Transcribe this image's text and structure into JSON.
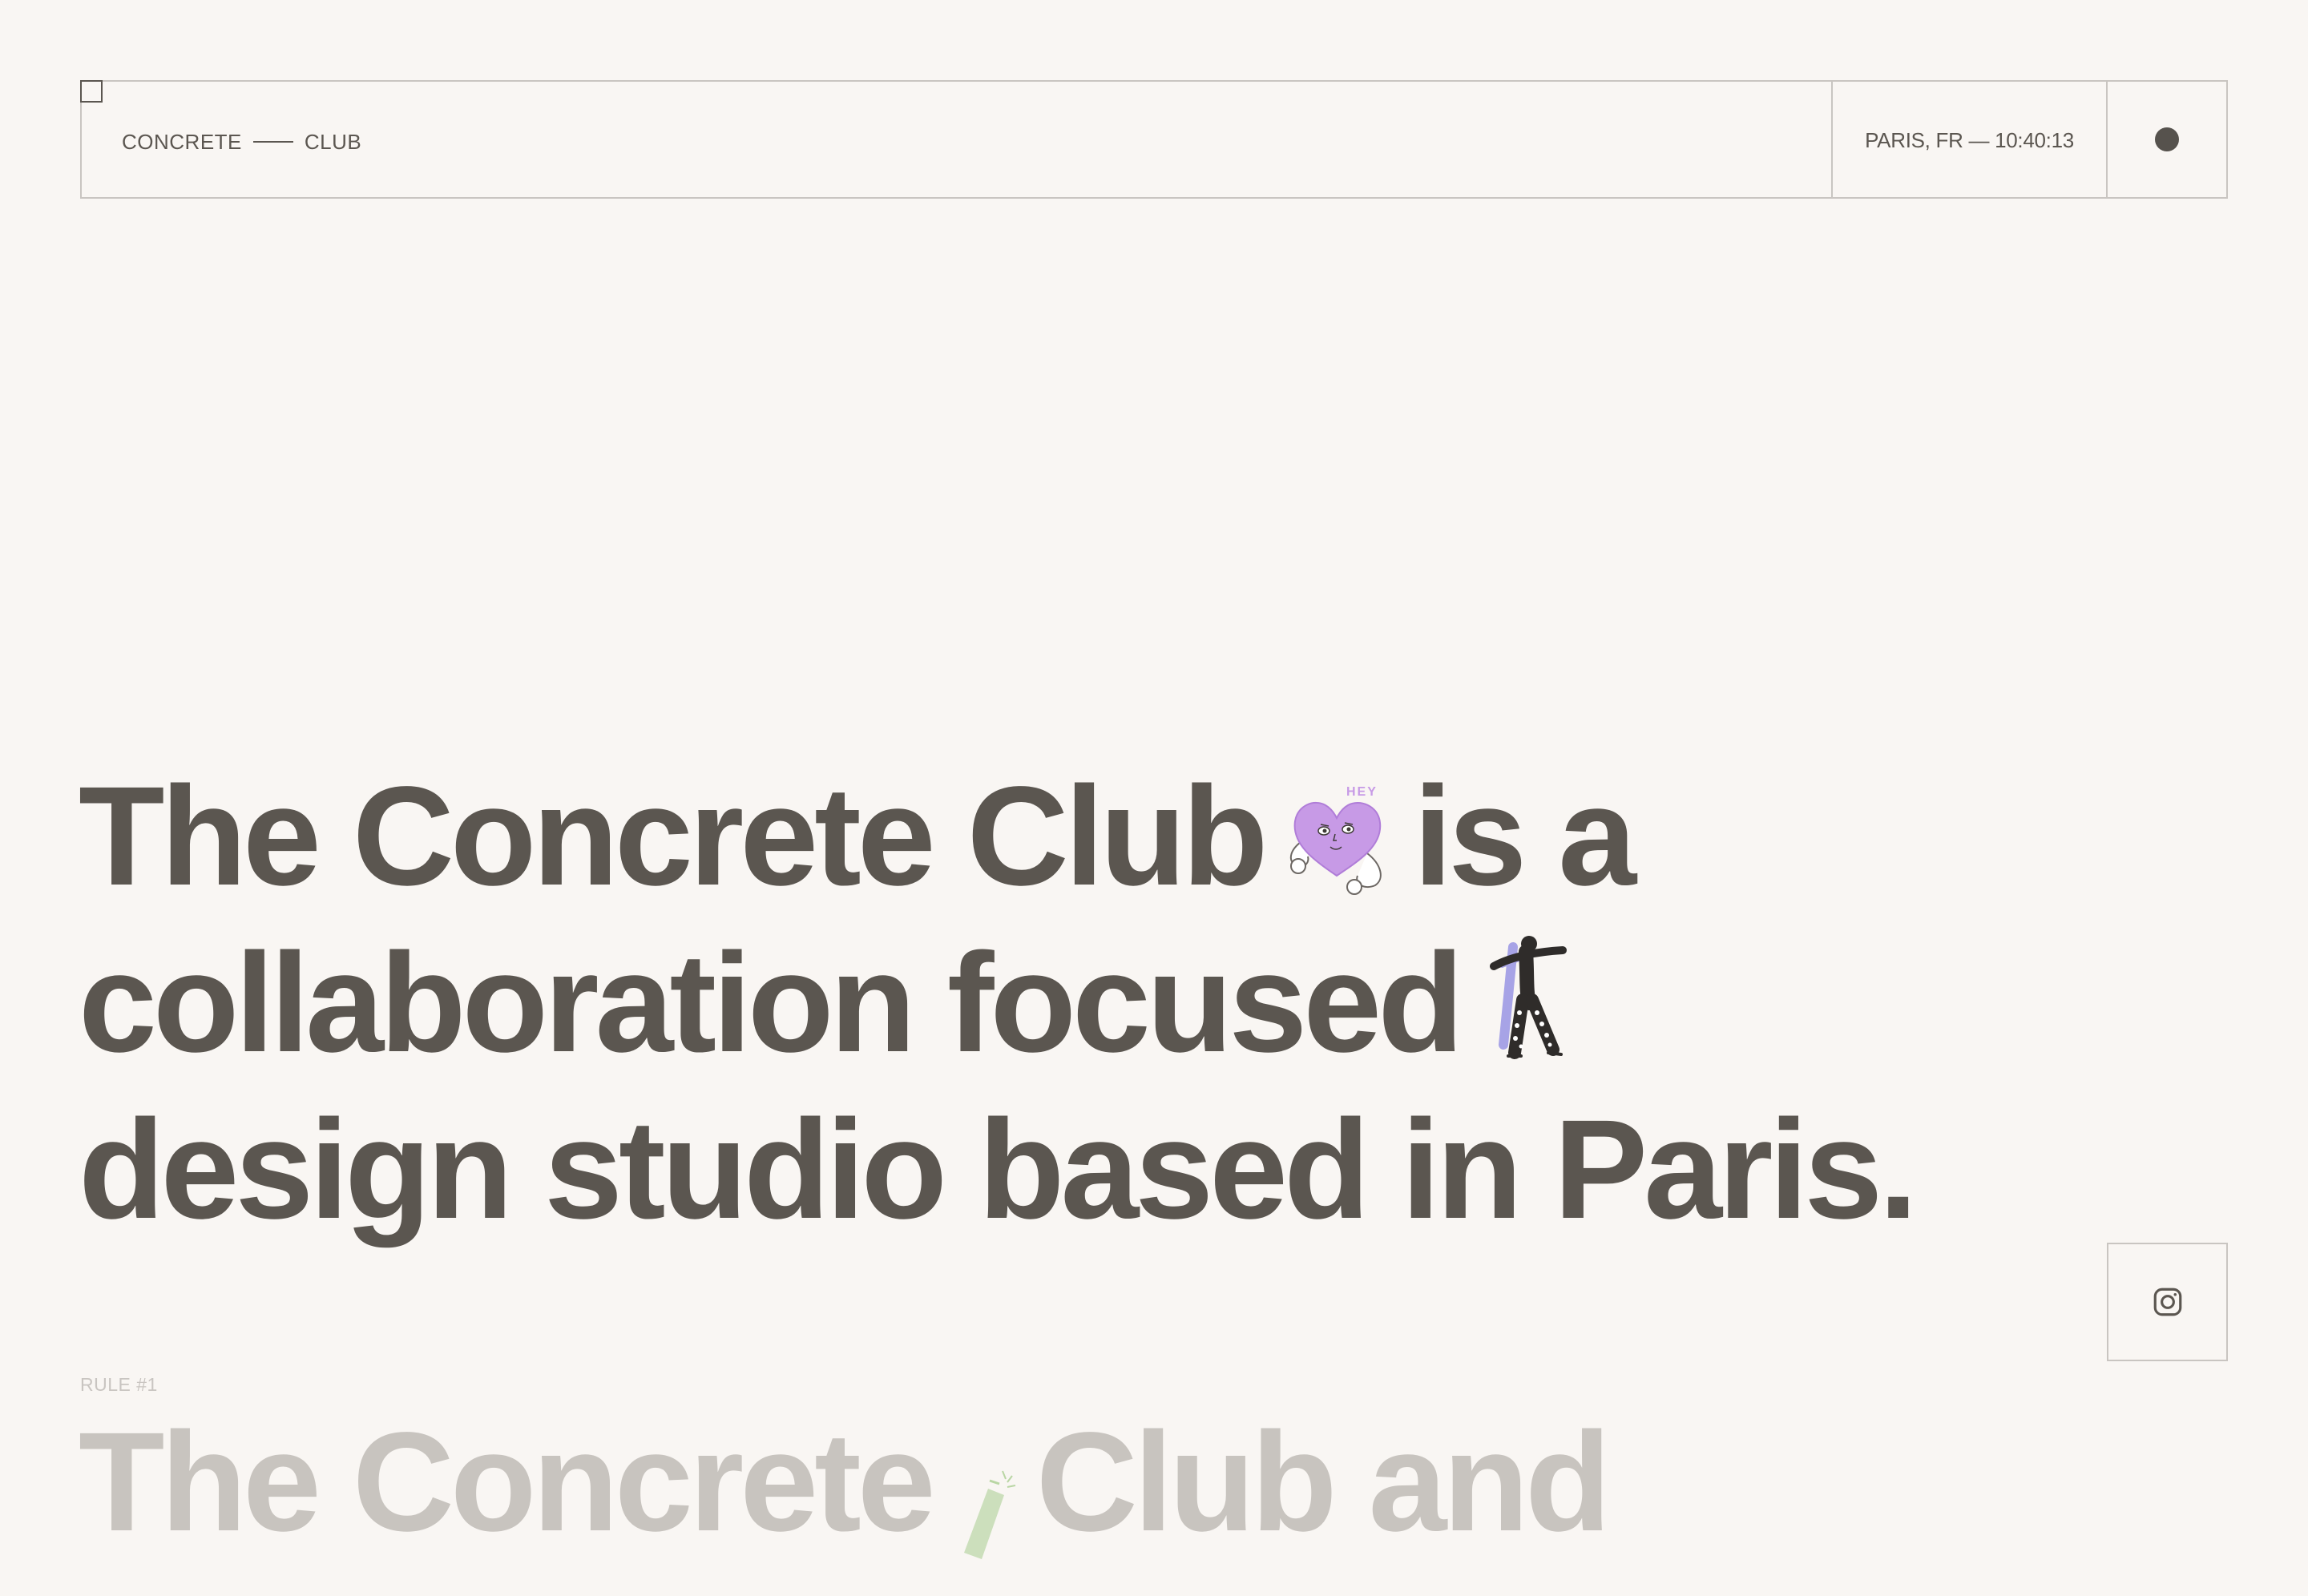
{
  "header": {
    "logo_left": "CONCRETE",
    "logo_right": "CLUB",
    "location_time": "PARIS, FR — 10:40:13"
  },
  "hero": {
    "line1_a": "The Concrete Club",
    "line1_b": "is a",
    "line2": "collaboration focused",
    "line3": "design studio based in Paris.",
    "heart_sticker_text": "HEY"
  },
  "rule": {
    "label": "RULE #1",
    "heading_a": "The Concrete",
    "heading_b": "Club and"
  },
  "icons": {
    "menu_dot": "circle-icon",
    "social": "instagram-icon",
    "corner": "square-icon"
  },
  "colors": {
    "background": "#f9f6f3",
    "text": "#5b5650",
    "border": "#c9c5c1",
    "faded_text": "#c8c4bf",
    "heart_fill": "#c79ae6"
  }
}
